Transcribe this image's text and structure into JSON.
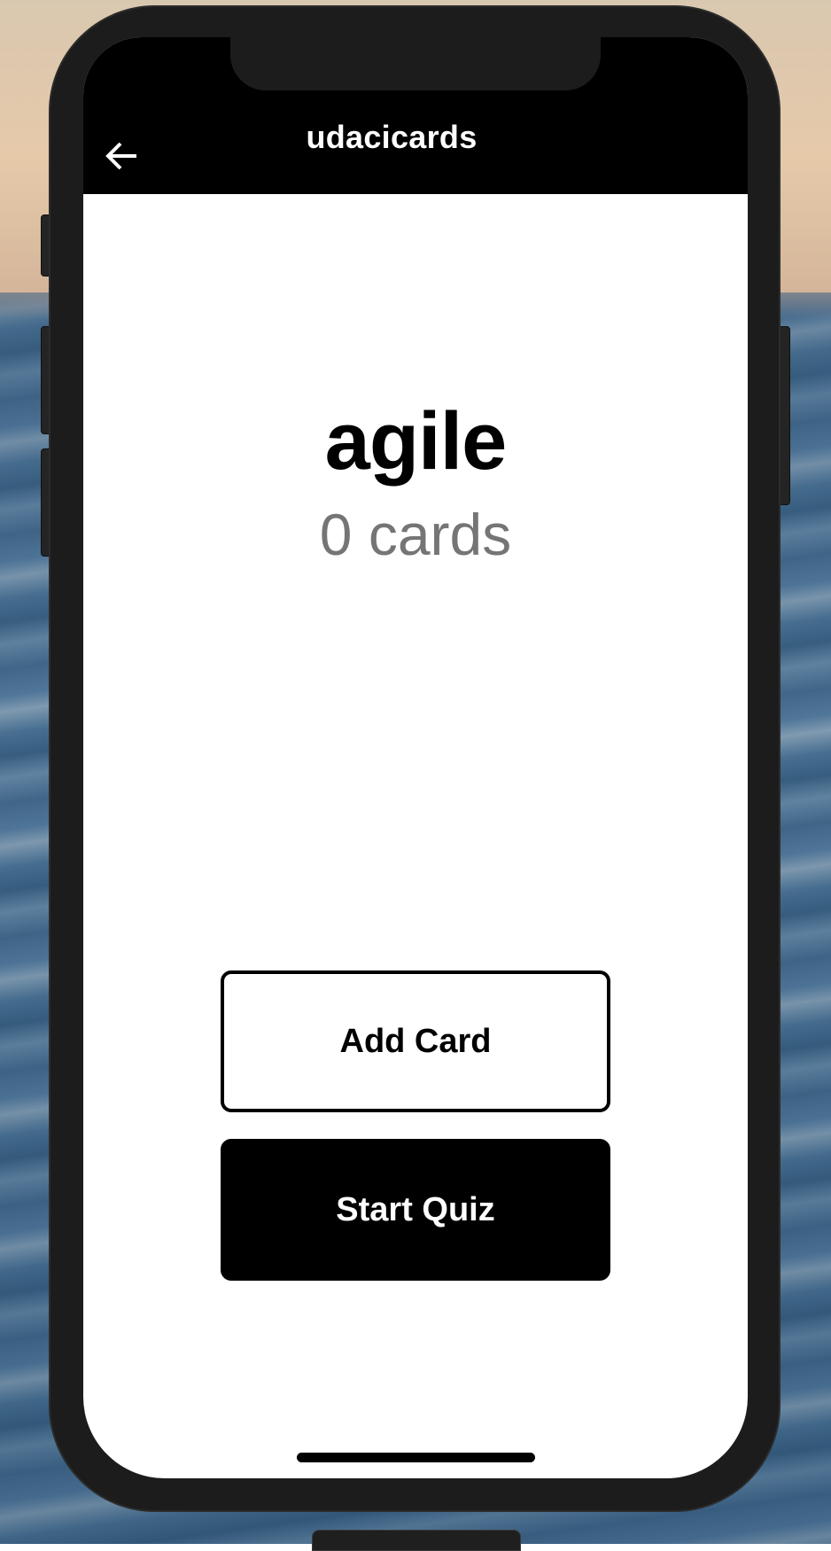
{
  "header": {
    "title": "udacicards",
    "back_icon": "arrow-left-icon"
  },
  "deck": {
    "title": "agile",
    "card_count": "0 cards"
  },
  "actions": {
    "add_card_label": "Add Card",
    "start_quiz_label": "Start Quiz"
  },
  "colors": {
    "header_bg": "#000000",
    "header_text": "#ffffff",
    "count_text": "#757575",
    "primary_button_bg": "#000000",
    "secondary_button_border": "#000000"
  }
}
